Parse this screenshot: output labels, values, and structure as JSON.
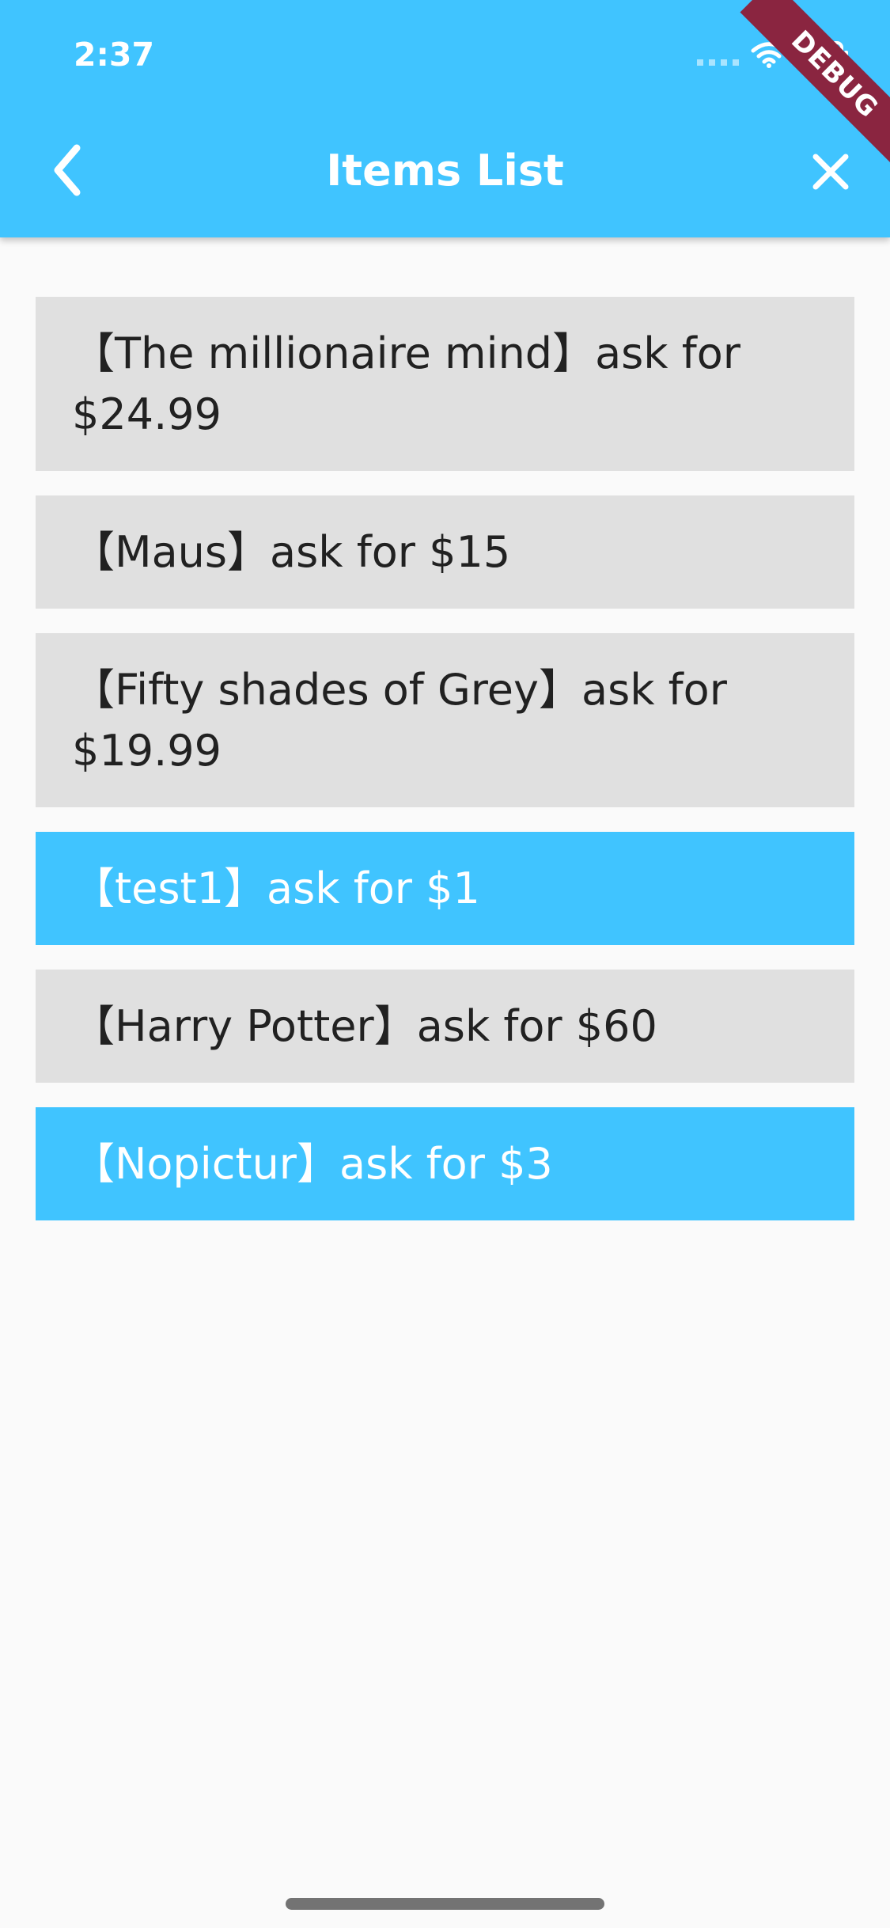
{
  "status_bar": {
    "time": "2:37",
    "signal_icon": "cellular-signal-icon",
    "wifi_icon": "wifi-icon",
    "battery_icon": "battery-icon"
  },
  "app_bar": {
    "title": "Items List",
    "back_icon": "chevron-left-icon",
    "close_icon": "close-icon"
  },
  "debug_banner": {
    "label": "DEBUG"
  },
  "items": [
    {
      "label": "【The millionaire mind】ask for $24.99",
      "highlighted": false
    },
    {
      "label": "【Maus】ask for $15",
      "highlighted": false
    },
    {
      "label": "【Fifty shades of Grey】ask for $19.99",
      "highlighted": false
    },
    {
      "label": "【test1】ask for $1",
      "highlighted": true
    },
    {
      "label": "【Harry Potter】ask for $60",
      "highlighted": false
    },
    {
      "label": "【Nopictur】ask for $3",
      "highlighted": true
    }
  ],
  "colors": {
    "primary": "#40c4ff",
    "item_background": "#e0e0e0",
    "text": "#212121",
    "background": "#fafafa",
    "debug_banner": "#8a2540"
  }
}
